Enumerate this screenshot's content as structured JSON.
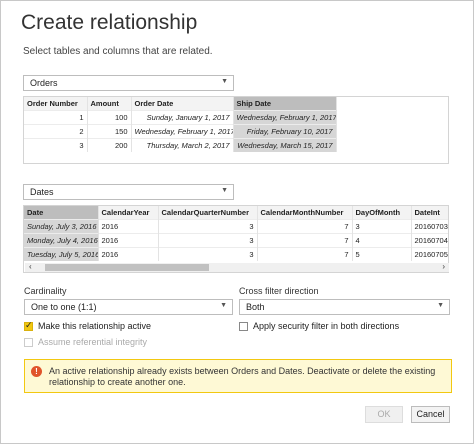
{
  "dialog": {
    "title": "Create relationship",
    "subtitle": "Select tables and columns that are related."
  },
  "table1": {
    "selected": "Orders",
    "headers": [
      "Order Number",
      "Amount",
      "Order Date",
      "Ship Date"
    ],
    "rows": [
      [
        "1",
        "100",
        "Sunday, January 1, 2017",
        "Wednesday, February 1, 2017"
      ],
      [
        "2",
        "150",
        "Wednesday, February 1, 2017",
        "Friday, February 10, 2017"
      ],
      [
        "3",
        "200",
        "Thursday, March 2, 2017",
        "Wednesday, March 15, 2017"
      ]
    ]
  },
  "table2": {
    "selected": "Dates",
    "headers": [
      "Date",
      "CalendarYear",
      "CalendarQuarterNumber",
      "CalendarMonthNumber",
      "DayOfMonth",
      "DateInt"
    ],
    "rows": [
      [
        "Sunday, July 3, 2016",
        "2016",
        "3",
        "7",
        "3",
        "20160703"
      ],
      [
        "Monday, July 4, 2016",
        "2016",
        "3",
        "7",
        "4",
        "20160704"
      ],
      [
        "Tuesday, July 5, 2016",
        "2016",
        "3",
        "7",
        "5",
        "20160705"
      ]
    ]
  },
  "scroll": {
    "left": "‹",
    "right": "›"
  },
  "cardinality": {
    "label": "Cardinality",
    "value": "One to one (1:1)"
  },
  "crossfilter": {
    "label": "Cross filter direction",
    "value": "Both"
  },
  "options": {
    "active": "Make this relationship active",
    "security": "Apply security filter in both directions",
    "referential": "Assume referential integrity"
  },
  "warning": {
    "icon": "!",
    "text": "An active relationship already exists between Orders and Dates. Deactivate or delete the existing relationship to create another one."
  },
  "buttons": {
    "ok": "OK",
    "cancel": "Cancel"
  },
  "icons": {
    "dropdown": "▼"
  },
  "colors": {
    "accent": "#f2c811",
    "warning_bg": "#fef9d5",
    "error": "#e0542b"
  }
}
